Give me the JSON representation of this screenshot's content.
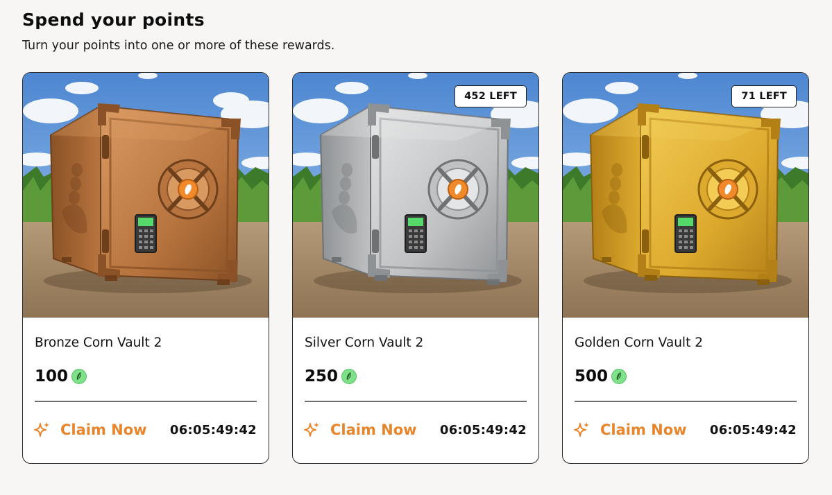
{
  "header": {
    "title": "Spend your points",
    "subtitle": "Turn your points into one or more of these rewards."
  },
  "cards": [
    {
      "name": "Bronze Corn Vault 2",
      "price": "100",
      "stock": "",
      "claim_label": "Claim Now",
      "timer": "06:05:49:42",
      "metal": {
        "light": "#d99a62",
        "mid": "#b8743e",
        "dark": "#8a5226",
        "shade": "#6e3f1b"
      }
    },
    {
      "name": "Silver Corn Vault 2",
      "price": "250",
      "stock": "452 LEFT",
      "claim_label": "Claim Now",
      "timer": "06:05:49:42",
      "metal": {
        "light": "#e4e5e6",
        "mid": "#bfc1c3",
        "dark": "#8f9294",
        "shade": "#6f7274"
      }
    },
    {
      "name": "Golden Corn Vault 2",
      "price": "500",
      "stock": "71 LEFT",
      "claim_label": "Claim Now",
      "timer": "06:05:49:42",
      "metal": {
        "light": "#f2cc55",
        "mid": "#ddaa2e",
        "dark": "#b37f17",
        "shade": "#8a5f0d"
      }
    }
  ],
  "colors": {
    "accent": "#e8842a",
    "coin": "#7fe08a",
    "sky_top": "#4d86d1",
    "sky_bottom": "#a8cdf0",
    "ground": "#a08565"
  },
  "icons": {
    "currency": "corn-coin-icon",
    "claim": "sparkle-icon",
    "vault": "vault-safe-icon"
  }
}
